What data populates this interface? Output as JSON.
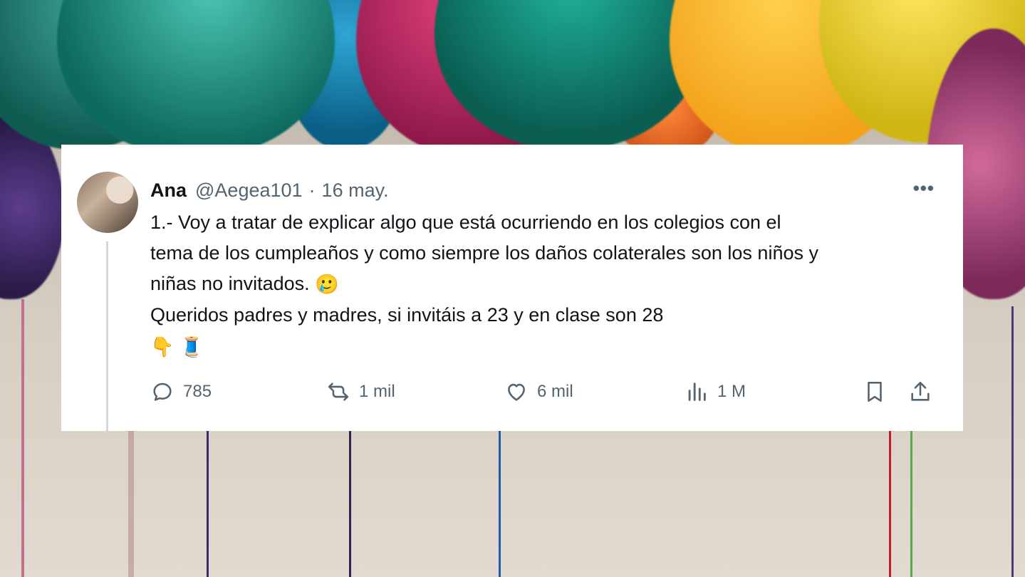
{
  "tweet": {
    "display_name": "Ana",
    "handle": "@Aegea101",
    "separator": "·",
    "date": "16 may.",
    "more_label": "•••",
    "line1": "1.- Voy a tratar de explicar algo que está ocurriendo en los colegios con el",
    "line2": "tema de los cumpleaños y como siempre los daños colaterales son los niños y",
    "line3": "niñas no invitados.",
    "line4": "Queridos padres y madres, si invitáis a 23 y en clase son 28",
    "emoji_sad": "🥲",
    "emoji_point": "👇",
    "emoji_thread": "🧵"
  },
  "actions": {
    "replies": "785",
    "retweets": "1 mil",
    "likes": "6 mil",
    "views": "1 M"
  },
  "colors": {
    "card_bg": "#ffffff",
    "text": "#0f1419",
    "secondary": "#536471"
  }
}
